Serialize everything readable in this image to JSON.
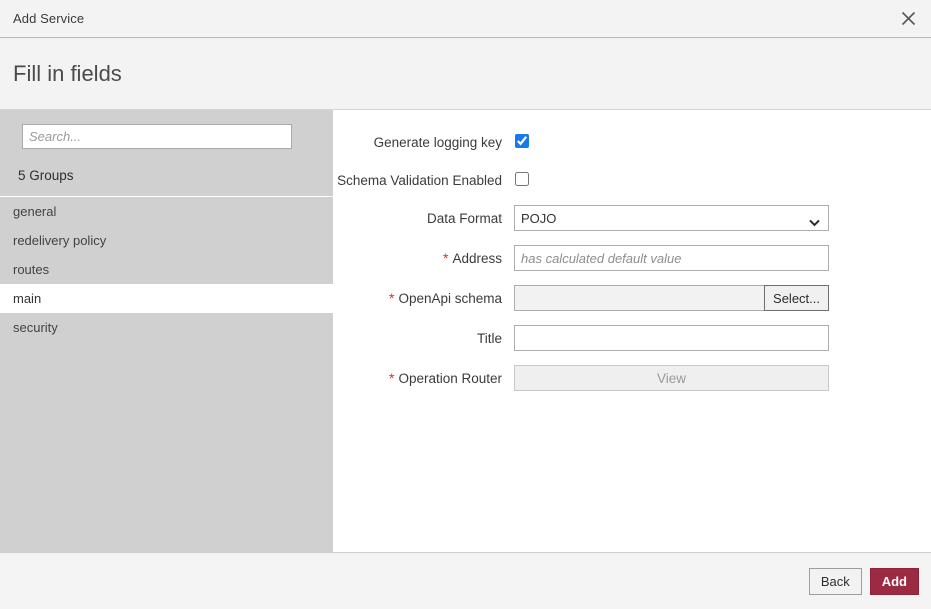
{
  "window": {
    "title": "Add Service",
    "close_icon": "close-x-icon"
  },
  "step": {
    "heading": "Fill in fields"
  },
  "sidebar": {
    "search": {
      "value": "",
      "placeholder": "Search..."
    },
    "group_count_label": "5 Groups",
    "items": [
      {
        "label": "general",
        "selected": false
      },
      {
        "label": "redelivery policy",
        "selected": false
      },
      {
        "label": "routes",
        "selected": false
      },
      {
        "label": "main",
        "selected": true
      },
      {
        "label": "security",
        "selected": false
      }
    ]
  },
  "form": {
    "fields": [
      {
        "label": "Generate logging key",
        "required": false,
        "type": "checkbox",
        "checked": true
      },
      {
        "label": "Schema Validation Enabled",
        "required": false,
        "type": "checkbox",
        "checked": false
      },
      {
        "label": "Data Format",
        "required": false,
        "type": "select",
        "value": "POJO",
        "options": [
          "POJO"
        ]
      },
      {
        "label": "Address",
        "required": true,
        "type": "text",
        "value": "",
        "placeholder": "has calculated default value"
      },
      {
        "label": "OpenApi schema",
        "required": true,
        "type": "input-button",
        "value": "",
        "placeholder": "",
        "button_label": "Select..."
      },
      {
        "label": "Title",
        "required": false,
        "type": "text",
        "value": "",
        "placeholder": ""
      },
      {
        "label": "Operation Router",
        "required": true,
        "type": "wide-button",
        "button_label": "View"
      }
    ],
    "required_marker": "*"
  },
  "footer": {
    "back_label": "Back",
    "add_label": "Add"
  },
  "colors": {
    "accent_primary": "#9c2a42",
    "checkbox_checked": "#1779ea",
    "required_star": "#e02828",
    "sidebar_bg": "#d0d0d0",
    "header_bg": "#f3f3f3",
    "footer_bg": "#f4f4f4"
  }
}
